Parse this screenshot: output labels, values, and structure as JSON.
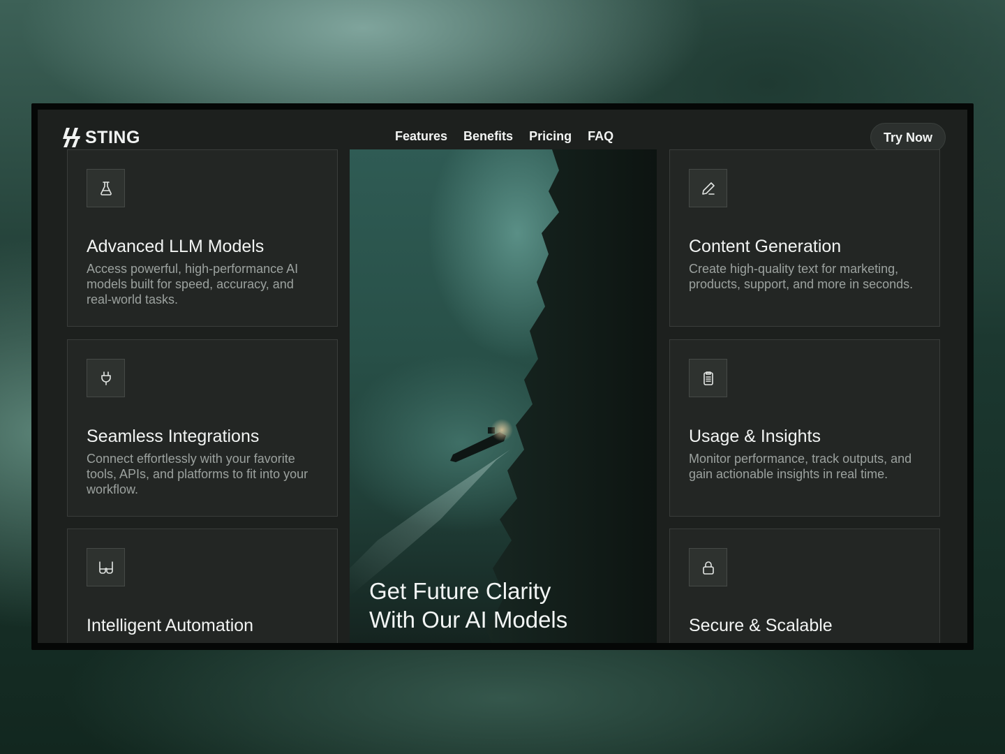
{
  "brand": {
    "name": "STING",
    "logo_icon": "bolt-logo-icon"
  },
  "nav": {
    "items": [
      {
        "label": "Features"
      },
      {
        "label": "Benefits"
      },
      {
        "label": "Pricing"
      },
      {
        "label": "FAQ"
      }
    ],
    "cta_label": "Try Now"
  },
  "hero": {
    "line1": "Get Future Clarity",
    "line2": "With Our AI Models"
  },
  "features": {
    "left": [
      {
        "icon": "flask-icon",
        "title": "Advanced LLM Models",
        "desc": "Access powerful, high-performance AI models built for speed, accuracy, and real-world tasks."
      },
      {
        "icon": "plug-icon",
        "title": "Seamless Integrations",
        "desc": "Connect effortlessly with your favorite tools, APIs, and platforms to fit into your workflow."
      },
      {
        "icon": "glasses-icon",
        "title": "Intelligent Automation",
        "desc": ""
      }
    ],
    "right": [
      {
        "icon": "pen-icon",
        "title": "Content Generation",
        "desc": "Create high-quality text for marketing, products, support, and more in seconds."
      },
      {
        "icon": "clipboard-icon",
        "title": "Usage & Insights",
        "desc": "Monitor performance, track outputs, and gain actionable insights in real time."
      },
      {
        "icon": "lock-icon",
        "title": "Secure & Scalable",
        "desc": ""
      }
    ]
  },
  "colors": {
    "background": "#1d201e",
    "card": "#232624",
    "card_border": "#3a3d3b",
    "text_primary": "#f2f4f3",
    "text_secondary": "#9ca29f"
  }
}
